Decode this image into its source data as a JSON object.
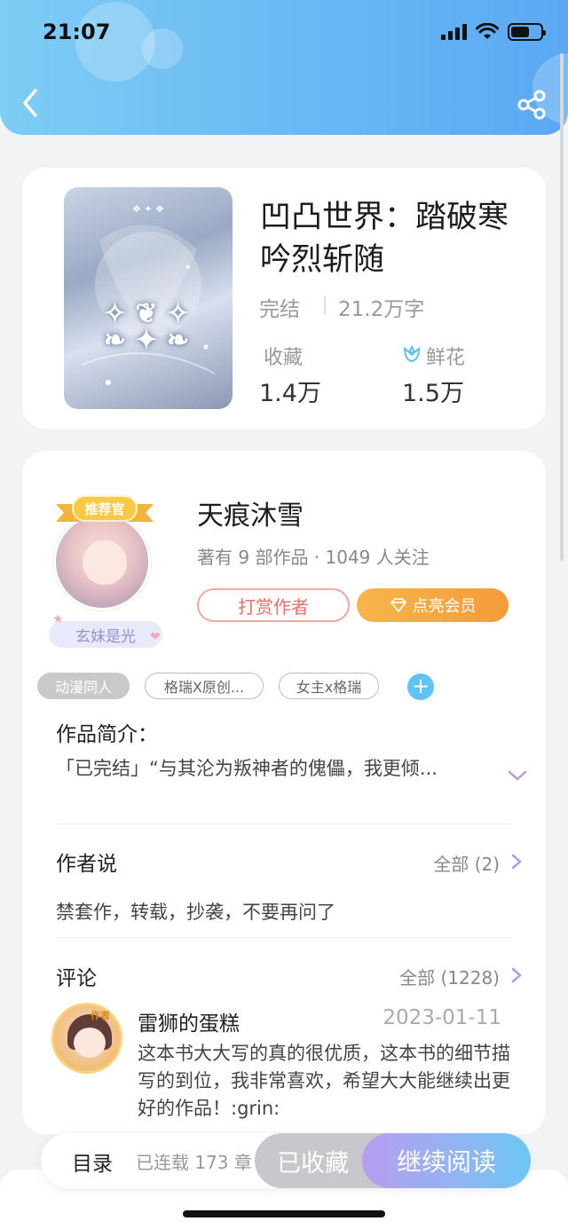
{
  "status_bar": {
    "time": "21:07"
  },
  "book": {
    "title": "凹凸世界：踏破寒吟烈斩随",
    "status": "完结",
    "word_count": "21.2万字",
    "favorites_label": "收藏",
    "favorites_value": "1.4万",
    "flowers_label": "鲜花",
    "flowers_value": "1.5万"
  },
  "author": {
    "badge": "推荐官",
    "name": "天痕沐雪",
    "info": "著有 9 部作品 · 1049 人关注",
    "fan_tag": "玄妹是光",
    "tip_button": "打赏作者",
    "vip_button": "点亮会员"
  },
  "tags": [
    "动漫同人",
    "格瑞X原创...",
    "女主x格瑞"
  ],
  "intro": {
    "title": "作品简介：",
    "text": "「已完结」“与其沦为叛神者的傀儡，我更倾..."
  },
  "author_say": {
    "title": "作者说",
    "more": "全部 (2)",
    "text": "禁套作，转载，抄袭，不要再问了"
  },
  "comments": {
    "title": "评论",
    "more": "全部 (1228)",
    "items": [
      {
        "author_mark": "作者",
        "user": "雷狮的蛋糕",
        "date": "2023-01-11",
        "text": "这本书大大写的真的很优质，这本书的细节描写的到位，我非常喜欢，希望大大能继续出更好的作品！:grin:"
      }
    ]
  },
  "bottom_bar": {
    "toc": "目录",
    "serial": "已连载 173 章",
    "collected": "已收藏",
    "continue": "继续阅读"
  },
  "colors": {
    "header_gradient_start": "#7ecdf5",
    "header_gradient_end": "#5aa8f2",
    "tip_red": "#ea6f66",
    "vip_orange": "#f39c3a",
    "read_gradient_start": "#b79ef0",
    "read_gradient_end": "#6cc7f3"
  }
}
